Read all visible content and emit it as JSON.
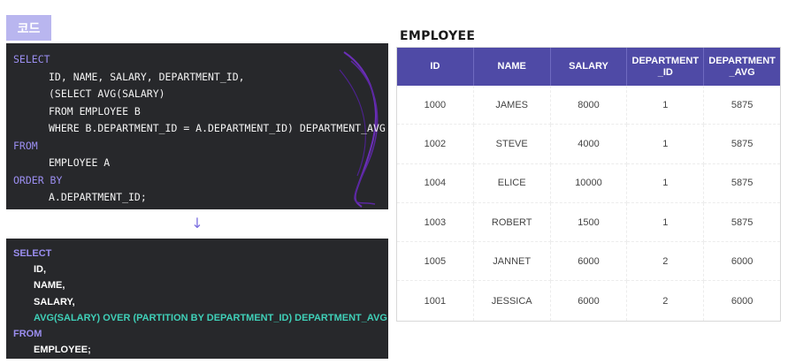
{
  "tag_label": "코드",
  "code_block_1": {
    "lines": [
      {
        "text": "SELECT",
        "kind": "kw"
      },
      {
        "text": "ID, NAME, SALARY, DEPARTMENT_ID,",
        "kind": "in"
      },
      {
        "text": "(SELECT AVG(SALARY)",
        "kind": "in"
      },
      {
        "text": "FROM EMPLOYEE B",
        "kind": "in"
      },
      {
        "text": "WHERE B.DEPARTMENT_ID = A.DEPARTMENT_ID) DEPARTMENT_AVG",
        "kind": "in"
      },
      {
        "text": "FROM",
        "kind": "kw"
      },
      {
        "text": "EMPLOYEE A",
        "kind": "in"
      },
      {
        "text": "ORDER BY",
        "kind": "kw"
      },
      {
        "text": "A.DEPARTMENT_ID;",
        "kind": "in"
      }
    ]
  },
  "arrow_icon": "down-arrow-icon",
  "code_block_2": {
    "lines": [
      {
        "text": "SELECT",
        "kind": "kw"
      },
      {
        "text": "ID,",
        "kind": "in"
      },
      {
        "text": "NAME,",
        "kind": "in"
      },
      {
        "text": "SALARY,",
        "kind": "in"
      },
      {
        "text": "AVG(SALARY) OVER (PARTITION BY DEPARTMENT_ID) DEPARTMENT_AVG",
        "kind": "teal"
      },
      {
        "text": "FROM",
        "kind": "kw"
      },
      {
        "text": "EMPLOYEE;",
        "kind": "in"
      }
    ]
  },
  "table": {
    "title": "EMPLOYEE",
    "headers": [
      "ID",
      "NAME",
      "SALARY",
      "DEPARTMENT\n_ID",
      "DEPARTMENT\n_AVG"
    ],
    "rows": [
      [
        "1000",
        "JAMES",
        "8000",
        "1",
        "5875"
      ],
      [
        "1002",
        "STEVE",
        "4000",
        "1",
        "5875"
      ],
      [
        "1004",
        "ELICE",
        "10000",
        "1",
        "5875"
      ],
      [
        "1003",
        "ROBERT",
        "1500",
        "1",
        "5875"
      ],
      [
        "1005",
        "JANNET",
        "6000",
        "2",
        "6000"
      ],
      [
        "1001",
        "JESSICA",
        "6000",
        "2",
        "6000"
      ]
    ]
  },
  "colors": {
    "tag_bg": "#b9b6ef",
    "code_bg": "#27282b",
    "keyword": "#9b8ef0",
    "teal": "#3fd0b8",
    "header_bg": "#4f4aa6"
  }
}
